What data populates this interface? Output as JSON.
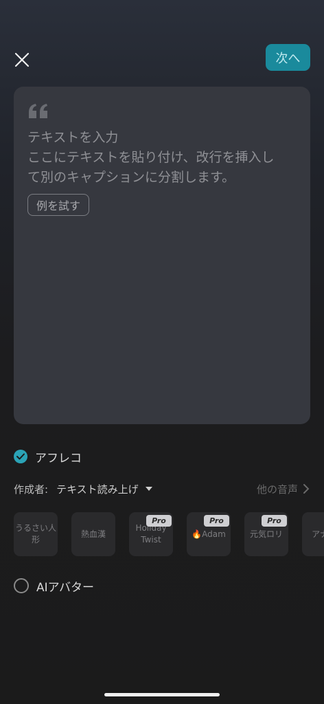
{
  "header": {
    "next_label": "次へ"
  },
  "card": {
    "title": "テキストを入力",
    "hint_line1": "ここにテキストを貼り付け、改行を挿入し",
    "hint_line2": "て別のキャプションに分割します。",
    "try_example_label": "例を試す"
  },
  "afureko": {
    "label": "アフレコ",
    "checked": true
  },
  "creator": {
    "label": "作成者:",
    "value": "テキスト読み上げ",
    "more_label": "他の音声"
  },
  "voices": [
    {
      "name": "うるさい人形",
      "pro": false
    },
    {
      "name": "熱血漢",
      "pro": false
    },
    {
      "name": "Holiday Twist",
      "pro": true
    },
    {
      "name": "🔥Adam",
      "pro": true
    },
    {
      "name": "元気ロリ",
      "pro": true
    },
    {
      "name": "アナサ",
      "pro": false
    }
  ],
  "pro_badge_label": "Pro",
  "ai_avatar": {
    "label": "AIアバター",
    "checked": false
  },
  "colors": {
    "accent": "#2ba3b6",
    "next_button": "#1a8a9c"
  }
}
